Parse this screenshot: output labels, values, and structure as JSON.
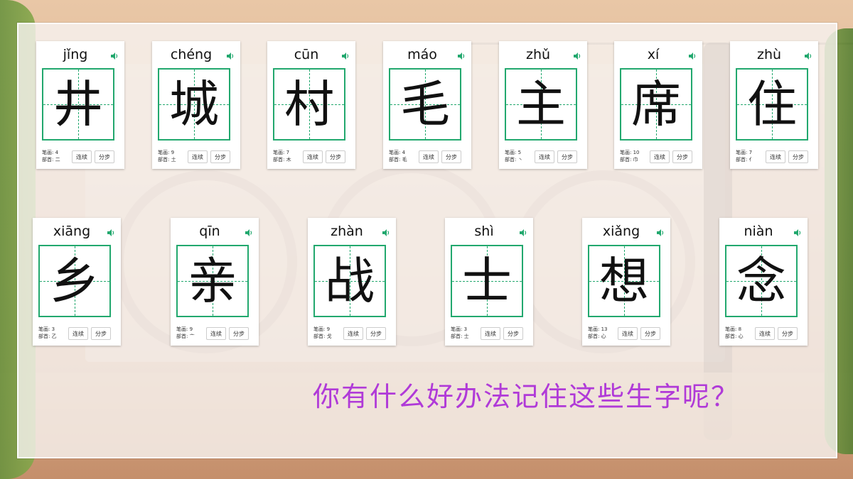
{
  "row1": [
    {
      "pinyin": "jǐng",
      "char": "井",
      "strokes": "4",
      "radical": "二"
    },
    {
      "pinyin": "chéng",
      "char": "城",
      "strokes": "9",
      "radical": "土"
    },
    {
      "pinyin": "cūn",
      "char": "村",
      "strokes": "7",
      "radical": "木"
    },
    {
      "pinyin": "máo",
      "char": "毛",
      "strokes": "4",
      "radical": "毛"
    },
    {
      "pinyin": "zhǔ",
      "char": "主",
      "strokes": "5",
      "radical": "丶"
    },
    {
      "pinyin": "xí",
      "char": "席",
      "strokes": "10",
      "radical": "巾"
    },
    {
      "pinyin": "zhù",
      "char": "住",
      "strokes": "7",
      "radical": "亻"
    }
  ],
  "row2": [
    {
      "pinyin": "xiāng",
      "char": "乡",
      "strokes": "3",
      "radical": "乙"
    },
    {
      "pinyin": "qīn",
      "char": "亲",
      "strokes": "9",
      "radical": "亠"
    },
    {
      "pinyin": "zhàn",
      "char": "战",
      "strokes": "9",
      "radical": "戈"
    },
    {
      "pinyin": "shì",
      "char": "士",
      "strokes": "3",
      "radical": "士"
    },
    {
      "pinyin": "xiǎng",
      "char": "想",
      "strokes": "13",
      "radical": "心"
    },
    {
      "pinyin": "niàn",
      "char": "念",
      "strokes": "8",
      "radical": "心"
    }
  ],
  "labels": {
    "strokes": "笔画:",
    "radical": "部首:",
    "continuous": "连续",
    "step": "分步"
  },
  "question": "你有什么好办法记住这些生字呢？",
  "colors": {
    "grid": "#22a86e",
    "question": "#b03ad8",
    "speaker": "#22a86e"
  }
}
